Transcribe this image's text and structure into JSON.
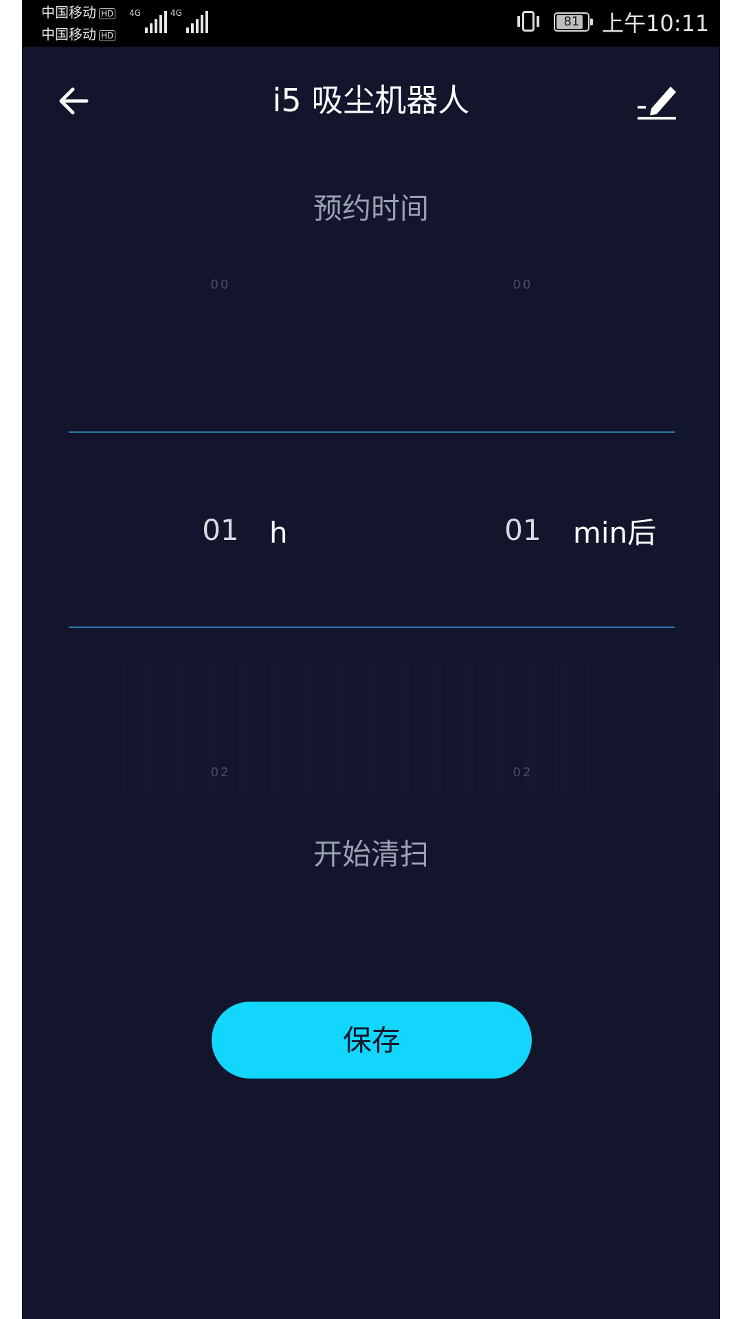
{
  "status_bar": {
    "carrier1": "中国移动",
    "carrier2": "中国移动",
    "hd": "HD",
    "network": "4G",
    "battery": "81",
    "time": "上午10:11"
  },
  "header": {
    "title": "i5 吸尘机器人",
    "back_icon": "arrow-left-icon",
    "edit_icon": "pencil-icon"
  },
  "schedule": {
    "section_title": "预约时间",
    "hours": {
      "above": "00",
      "selected": "01",
      "below": "02",
      "unit": "h"
    },
    "minutes": {
      "above": "00",
      "selected": "01",
      "below": "02",
      "unit": "min后"
    }
  },
  "start_label": "开始清扫",
  "save_button": "保存",
  "colors": {
    "background": "#12152b",
    "accent": "#12d6fb",
    "divider": "#2a7ab0"
  }
}
